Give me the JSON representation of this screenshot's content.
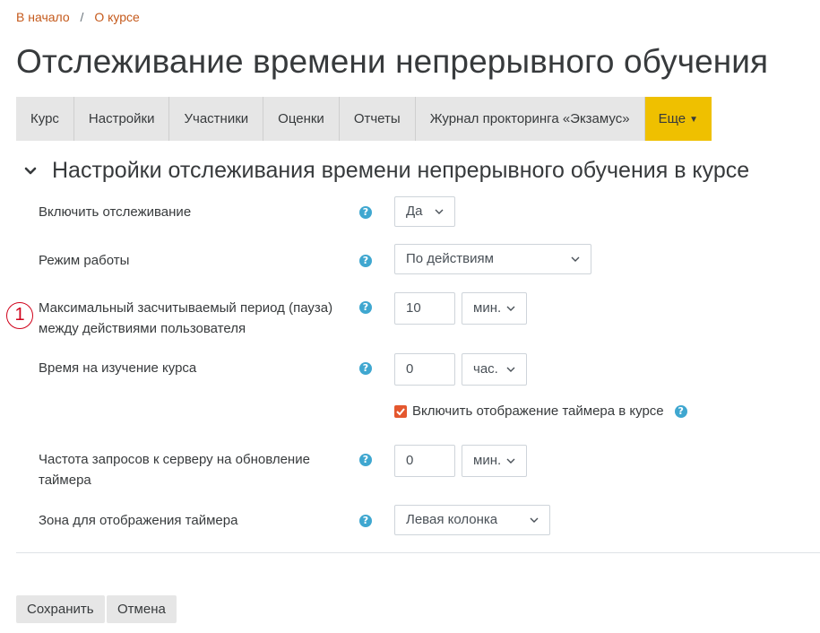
{
  "breadcrumb": {
    "home": "В начало",
    "separator": "/",
    "about": "О курсе"
  },
  "page_title": "Отслеживание времени непрерывного обучения",
  "tabs": [
    {
      "label": "Курс"
    },
    {
      "label": "Настройки"
    },
    {
      "label": "Участники"
    },
    {
      "label": "Оценки"
    },
    {
      "label": "Отчеты"
    },
    {
      "label": "Журнал прокторинга «Экзамус»"
    },
    {
      "label": "Еще"
    }
  ],
  "section": {
    "title": "Настройки отслеживания времени непрерывного обучения в курсе"
  },
  "fields": {
    "enable": {
      "label": "Включить отслеживание",
      "value": "Да"
    },
    "mode": {
      "label": "Режим работы",
      "value": "По действиям"
    },
    "max_pause": {
      "label_line1": "Максимальный засчитываемый период (пауза)",
      "label_line2": "между действиями пользователя",
      "value": "10",
      "unit": "мин."
    },
    "study_time": {
      "label": "Время на изучение курса",
      "value": "0",
      "unit": "час."
    },
    "timer_checkbox": {
      "label": "Включить отображение таймера в курсе",
      "checked": true
    },
    "request_freq": {
      "label_line1": "Частота запросов к серверу на обновление",
      "label_line2": "таймера",
      "value": "0",
      "unit": "мин."
    },
    "timer_zone": {
      "label": "Зона для отображения таймера",
      "value": "Левая колонка"
    }
  },
  "annotation_marker": "1",
  "buttons": {
    "save": "Сохранить",
    "cancel": "Отмена"
  },
  "colors": {
    "link": "#c55a1c",
    "active_tab": "#efc000",
    "help_icon": "#3fa7d0",
    "checkbox": "#e4572e",
    "marker": "#d0021b"
  }
}
